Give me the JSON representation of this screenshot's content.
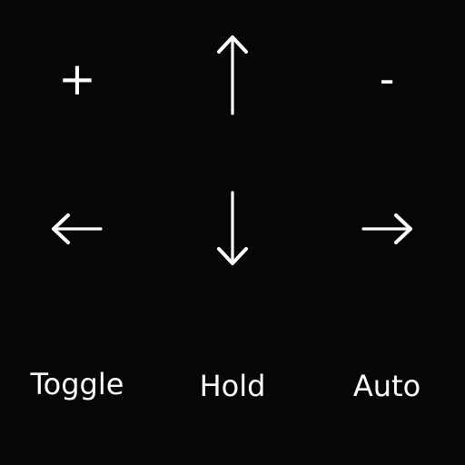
{
  "keypad": {
    "row1": {
      "left": {
        "icon": "plus-icon",
        "text": "+"
      },
      "center": {
        "icon": "arrow-up-icon"
      },
      "right": {
        "icon": "minus-icon",
        "text": "-"
      }
    },
    "row2": {
      "left": {
        "icon": "arrow-left-icon"
      },
      "center": {
        "icon": "arrow-down-icon"
      },
      "right": {
        "icon": "arrow-right-icon"
      }
    },
    "row3": {
      "left_label": "Toggle",
      "center_label": "Hold",
      "right_label": "Auto"
    }
  },
  "colors": {
    "background": "#060606",
    "foreground": "#ffffff"
  }
}
